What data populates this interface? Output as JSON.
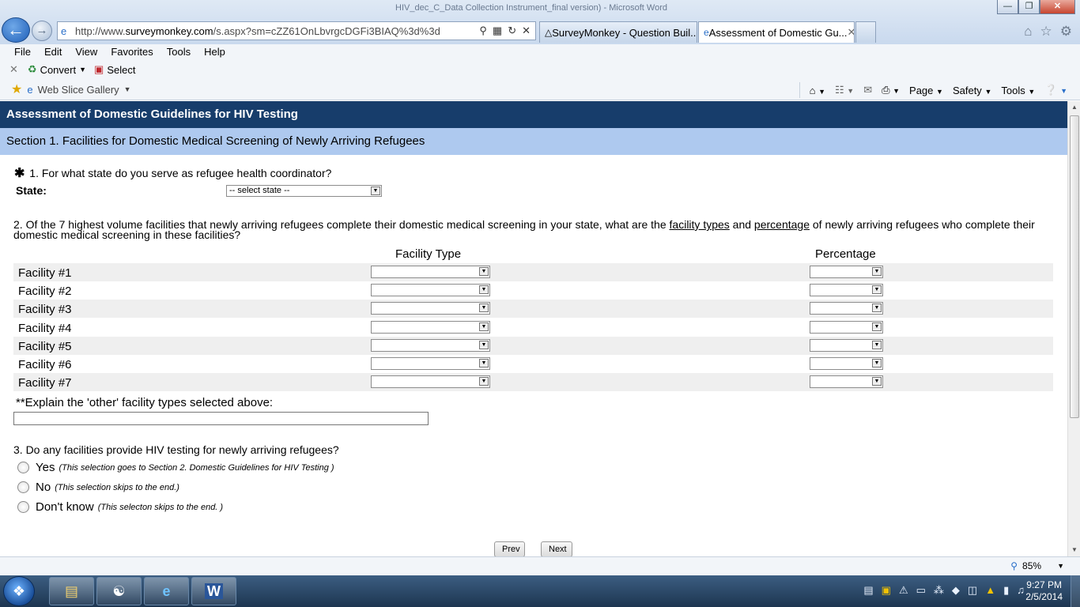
{
  "window": {
    "title": "HIV_dec_C_Data Collection Instrument_final version) - Microsoft Word",
    "controls": {
      "minimize": "—",
      "maximize": "❐",
      "close": "✕"
    }
  },
  "browser": {
    "url_prefix": "http://www.",
    "url_host": "surveymonkey.com",
    "url_path": "/s.aspx?sm=cZZ61OnLbvrgcDGFi3BIAQ%3d%3d",
    "tabs": [
      {
        "label": "SurveyMonkey - Question Buil...",
        "icon": "surveymonkey-icon"
      },
      {
        "label": "Assessment of Domestic Gu...",
        "icon": "ie-icon",
        "active": true
      }
    ],
    "menu": [
      "File",
      "Edit",
      "View",
      "Favorites",
      "Tools",
      "Help"
    ],
    "command_bar": {
      "convert": "Convert",
      "select": "Select"
    },
    "favorites": {
      "web_slice": "Web Slice Gallery"
    },
    "toolbar_right": {
      "page": "Page",
      "safety": "Safety",
      "tools": "Tools"
    },
    "zoom": "85%"
  },
  "survey": {
    "title": "Assessment of Domestic Guidelines for HIV Testing",
    "section": "Section 1. Facilities for Domestic Medical Screening of Newly Arriving Refugees",
    "q1": {
      "required": "✱",
      "text": "1. For what state do you serve as refugee health coordinator?",
      "state_label": "State:",
      "state_value": "-- select state --"
    },
    "q2": {
      "text_a": "2. Of the 7 highest volume facilities that newly arriving refugees complete their domestic medical screening in your state, what are the ",
      "text_link1": "facility types",
      "text_b": " and ",
      "text_link2": "percentage",
      "text_c": " of newly arriving refugees who complete their domestic medical screening in these facilities?",
      "col_type": "Facility Type",
      "col_pct": "Percentage",
      "facilities": [
        "Facility #1",
        "Facility #2",
        "Facility #3",
        "Facility #4",
        "Facility #5",
        "Facility #6",
        "Facility #7"
      ],
      "explain_label": "**Explain the 'other' facility types selected above:"
    },
    "q3": {
      "text": "3. Do any facilities provide HIV testing for newly arriving refugees?",
      "options": [
        {
          "label": "Yes",
          "note": "(This selection goes to Section 2. Domestic Guidelines for HIV Testing )"
        },
        {
          "label": "No",
          "note": "(This selection skips to the end.)"
        },
        {
          "label": "Don't know",
          "note": "(This selecton skips to the end. )"
        }
      ]
    },
    "nav": {
      "prev": "Prev",
      "next": "Next"
    }
  },
  "taskbar": {
    "time": "9:27 PM",
    "date": "2/5/2014"
  }
}
